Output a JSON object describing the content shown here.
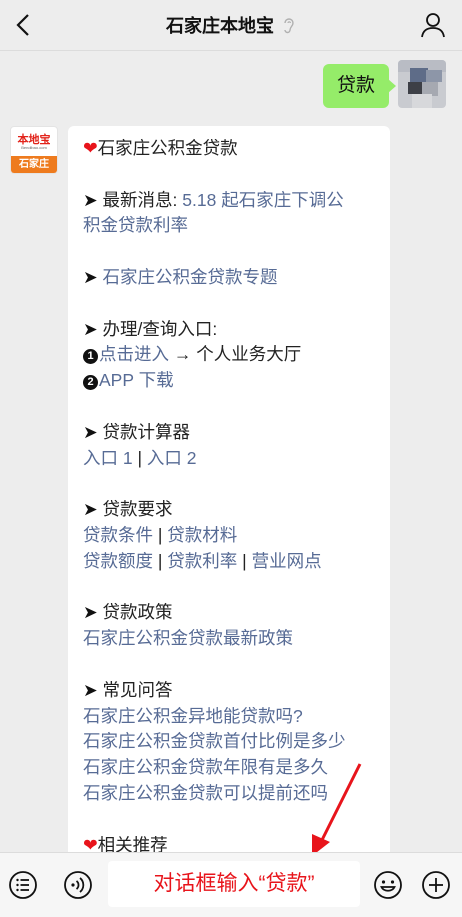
{
  "header": {
    "title": "石家庄本地宝"
  },
  "outgoing": {
    "text": "贷款"
  },
  "logo": {
    "brand": "本地宝",
    "sub": "Bendibao.com",
    "city": "石家庄"
  },
  "message": {
    "title": "石家庄公积金贷款",
    "news": {
      "label": "最新消息:",
      "link_line1": "5.18 起石家庄下调公",
      "link_line2": "积金贷款利率"
    },
    "topic": "石家庄公积金贷款专题",
    "handle": {
      "label": "办理/查询入口:",
      "num1": "1",
      "link1": "点击进入",
      "arrow_text": "→ 个人业务大厅",
      "num2": "2",
      "link2": "APP 下载"
    },
    "calculator": {
      "label": "贷款计算器",
      "link1": "入口 1",
      "link2": "入口 2"
    },
    "requirements": {
      "label": "贷款要求",
      "links_row1": [
        "贷款条件",
        "贷款材料"
      ],
      "links_row2": [
        "贷款额度",
        "贷款利率",
        "营业网点"
      ]
    },
    "policy": {
      "label": "贷款政策",
      "link": "石家庄公积金贷款最新政策"
    },
    "faq": {
      "label": "常见问答",
      "items": [
        "石家庄公积金异地能贷款吗?",
        "石家庄公积金贷款首付比例是多少",
        "石家庄公积金贷款年限有是多久",
        "石家庄公积金贷款可以提前还吗"
      ]
    },
    "related": "相关推荐",
    "separator": "|"
  },
  "input": {
    "value": "对话框输入“贷款”"
  },
  "colors": {
    "background": "#ededed",
    "outgoing_bubble": "#95ec69",
    "link": "#576b95",
    "heart": "#e8141b",
    "annotation": "#e8141b",
    "logo_orange": "#ee7b1e"
  }
}
